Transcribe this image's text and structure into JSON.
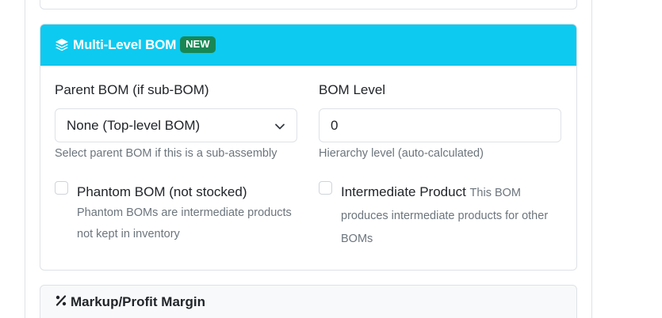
{
  "card": {
    "title": "Multi-Level BOM",
    "badge": "NEW",
    "icon": "layers-icon",
    "header_color": "#0dcaf0",
    "badge_color": "#198754"
  },
  "parent_bom": {
    "label": "Parent BOM (if sub-BOM)",
    "value": "None (Top-level BOM)",
    "help": "Select parent BOM if this is a sub-assembly"
  },
  "bom_level": {
    "label": "BOM Level",
    "value": "0",
    "help": "Hierarchy level (auto-calculated)"
  },
  "phantom": {
    "label": "Phantom BOM (not stocked)",
    "help": "Phantom BOMs are intermediate products not kept in inventory",
    "checked": false
  },
  "intermediate": {
    "label": "Intermediate Product",
    "help": "This BOM produces intermediate products for other BOMs",
    "checked": false
  },
  "next_section": {
    "title": "Markup/Profit Margin",
    "icon": "percent-icon"
  }
}
